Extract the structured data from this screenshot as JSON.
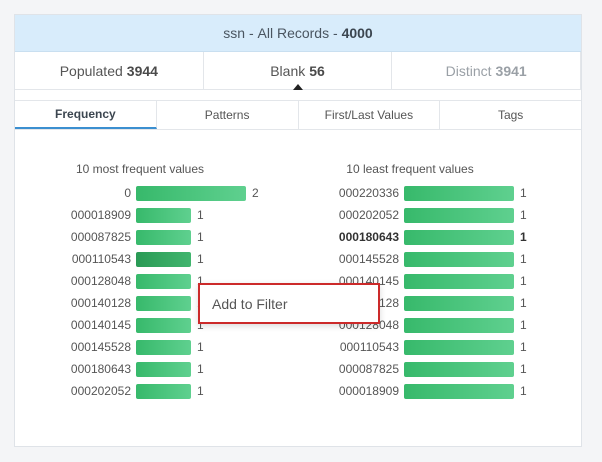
{
  "header": {
    "field": "ssn",
    "separator": " - ",
    "label": "All Records",
    "dash": " - ",
    "count": "4000"
  },
  "stats": [
    {
      "label": "Populated",
      "value": "3944"
    },
    {
      "label": "Blank",
      "value": "56"
    },
    {
      "label": "Distinct",
      "value": "3941"
    }
  ],
  "tabs": [
    {
      "label": "Frequency",
      "active": true
    },
    {
      "label": "Patterns"
    },
    {
      "label": "First/Last Values"
    },
    {
      "label": "Tags"
    }
  ],
  "most_frequent": {
    "title": "10 most frequent values",
    "rows": [
      {
        "value": "0",
        "count": 2
      },
      {
        "value": "000018909",
        "count": 1
      },
      {
        "value": "000087825",
        "count": 1
      },
      {
        "value": "000110543",
        "count": 1
      },
      {
        "value": "000128048",
        "count": 1
      },
      {
        "value": "000140128",
        "count": 1
      },
      {
        "value": "000140145",
        "count": 1
      },
      {
        "value": "000145528",
        "count": 1
      },
      {
        "value": "000180643",
        "count": 1
      },
      {
        "value": "000202052",
        "count": 1
      }
    ]
  },
  "least_frequent": {
    "title": "10 least frequent values",
    "rows": [
      {
        "value": "000220336",
        "count": 1
      },
      {
        "value": "000202052",
        "count": 1
      },
      {
        "value": "000180643",
        "count": 1,
        "bold": true
      },
      {
        "value": "000145528",
        "count": 1
      },
      {
        "value": "000140145",
        "count": 1
      },
      {
        "value": "000140128",
        "count": 1
      },
      {
        "value": "000128048",
        "count": 1
      },
      {
        "value": "000110543",
        "count": 1
      },
      {
        "value": "000087825",
        "count": 1
      },
      {
        "value": "000018909",
        "count": 1
      }
    ]
  },
  "context_menu": {
    "item": "Add to Filter"
  },
  "colors": {
    "bar": "#37b96b",
    "header_bg": "#d8ecfb",
    "menu_border": "#cc2a2a",
    "tab_active": "#3b8fd0"
  }
}
